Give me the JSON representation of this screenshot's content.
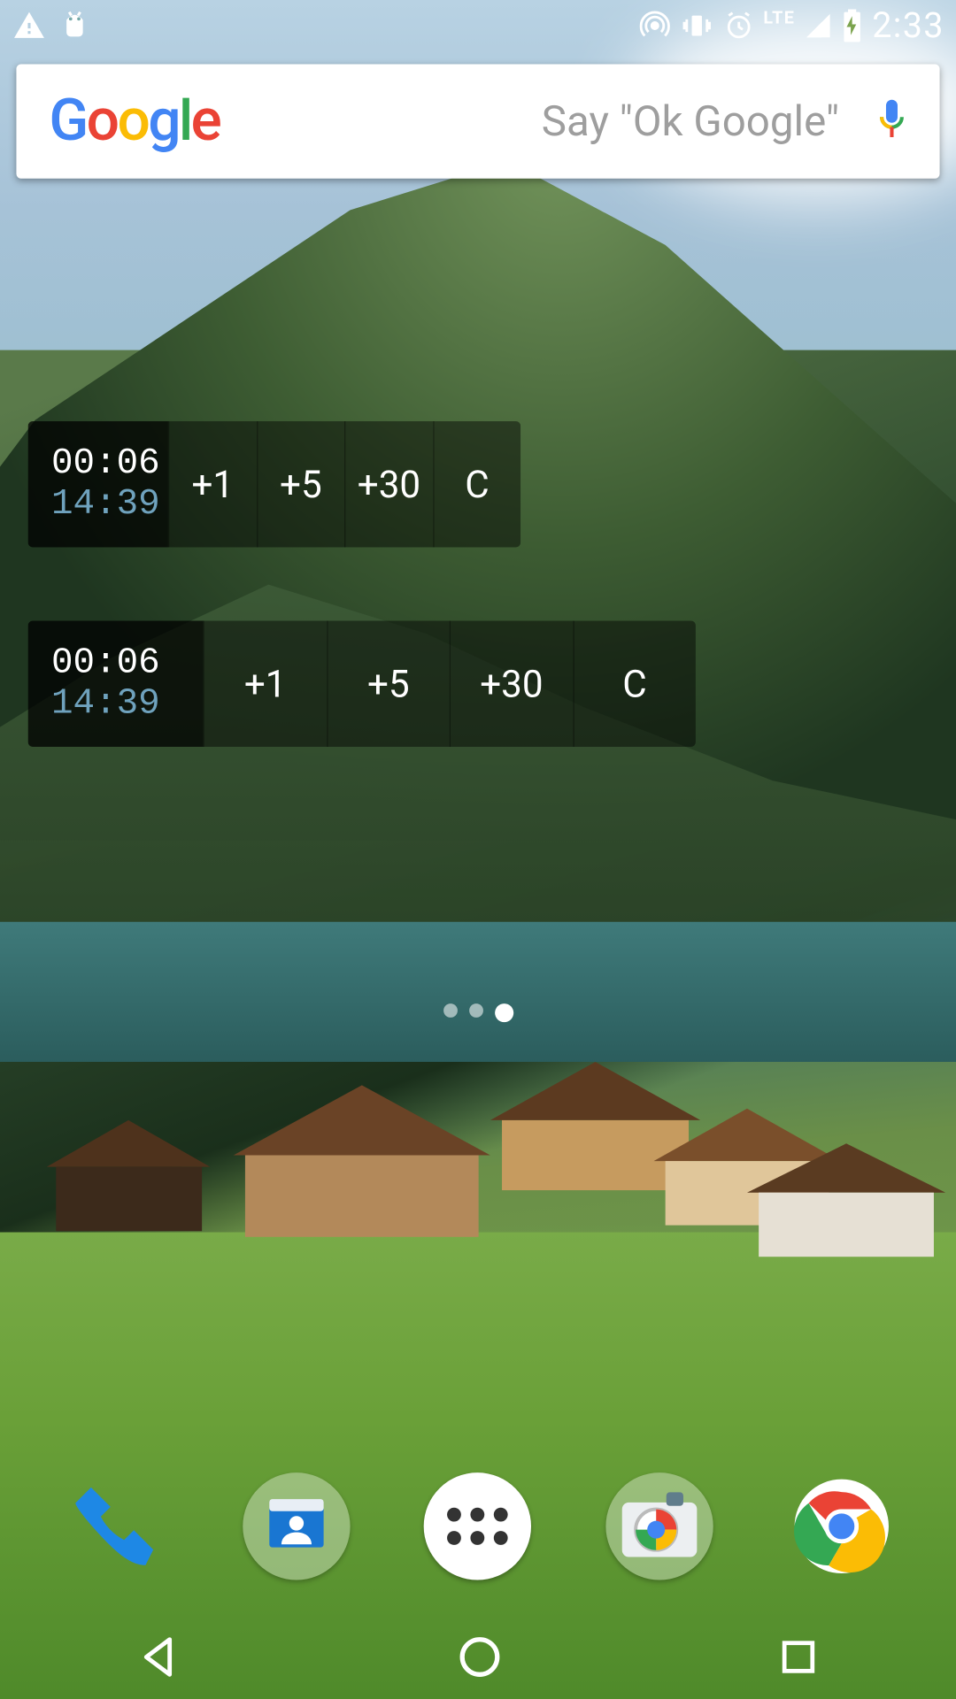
{
  "status_bar": {
    "time": "2:33",
    "lte_label": "LTE"
  },
  "search": {
    "hint": "Say \"Ok Google\""
  },
  "widgets": [
    {
      "elapsed": "00:06",
      "clock": "14:39",
      "buttons": {
        "b1": "+1",
        "b2": "+5",
        "b3": "+30",
        "clear": "C"
      }
    },
    {
      "elapsed": "00:06",
      "clock": "14:39",
      "buttons": {
        "b1": "+1",
        "b2": "+5",
        "b3": "+30",
        "clear": "C"
      }
    }
  ],
  "pager": {
    "count": 3,
    "active": 2
  }
}
